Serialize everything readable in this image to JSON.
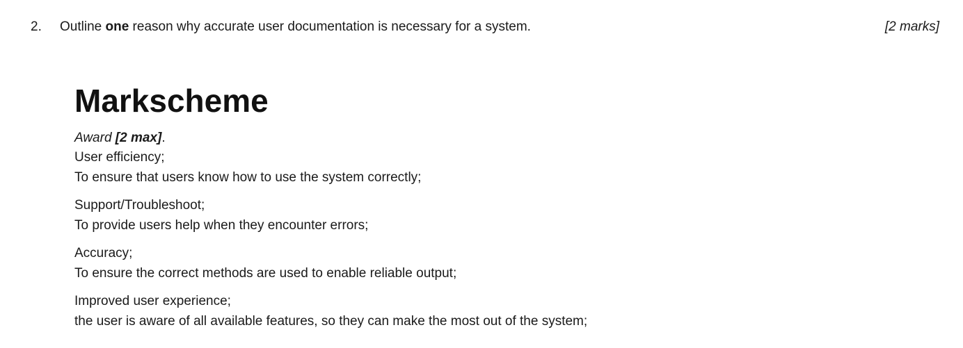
{
  "question": {
    "number": "2.",
    "text_before": "Outline ",
    "text_bold": "one",
    "text_after": " reason why accurate user documentation is necessary for a system.",
    "marks": "[2 marks]"
  },
  "markscheme": {
    "heading": "Markscheme",
    "award_prefix": "Award ",
    "award_bold": "[2 max]",
    "award_suffix": ".",
    "groups": [
      {
        "title": "User efficiency;",
        "detail": "To ensure that users know how to use the system correctly;"
      },
      {
        "title": "Support/Troubleshoot;",
        "detail": "To provide users help when they encounter errors;"
      },
      {
        "title": "Accuracy;",
        "detail": "To ensure the correct methods are used to enable reliable output;"
      },
      {
        "title": "Improved user experience;",
        "detail": "the user is aware of all available features, so they can make the most out of the system;"
      }
    ]
  }
}
